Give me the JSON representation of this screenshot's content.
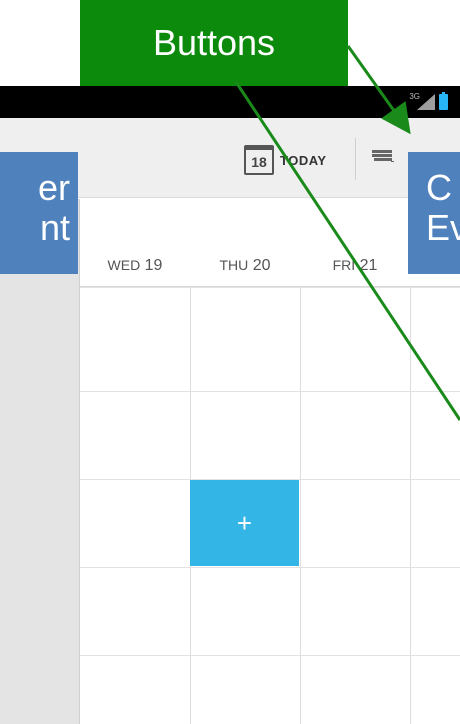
{
  "annotations": {
    "buttons_label": "Buttons",
    "left_callout_line1": "er",
    "left_callout_line2": "nt",
    "right_callout_line1": "C",
    "right_callout_line2": "Ev"
  },
  "statusbar": {
    "network_type": "3G"
  },
  "actionbar": {
    "today_icon_number": "18",
    "today_label": "TODAY"
  },
  "calendar": {
    "days": [
      {
        "dow": "WED",
        "date": "19"
      },
      {
        "dow": "THU",
        "date": "20"
      },
      {
        "dow": "FRI",
        "date": "21"
      }
    ],
    "new_event_symbol": "+"
  },
  "icons": {
    "today": "calendar-icon",
    "add_event": "add-event-icon",
    "signal": "signal-icon",
    "battery": "battery-icon"
  },
  "colors": {
    "annotation_green": "#0b8a0b",
    "annotation_blue": "#4f81bd",
    "new_event_blue": "#33b5e5",
    "arrow_green": "#1a8a1a"
  }
}
